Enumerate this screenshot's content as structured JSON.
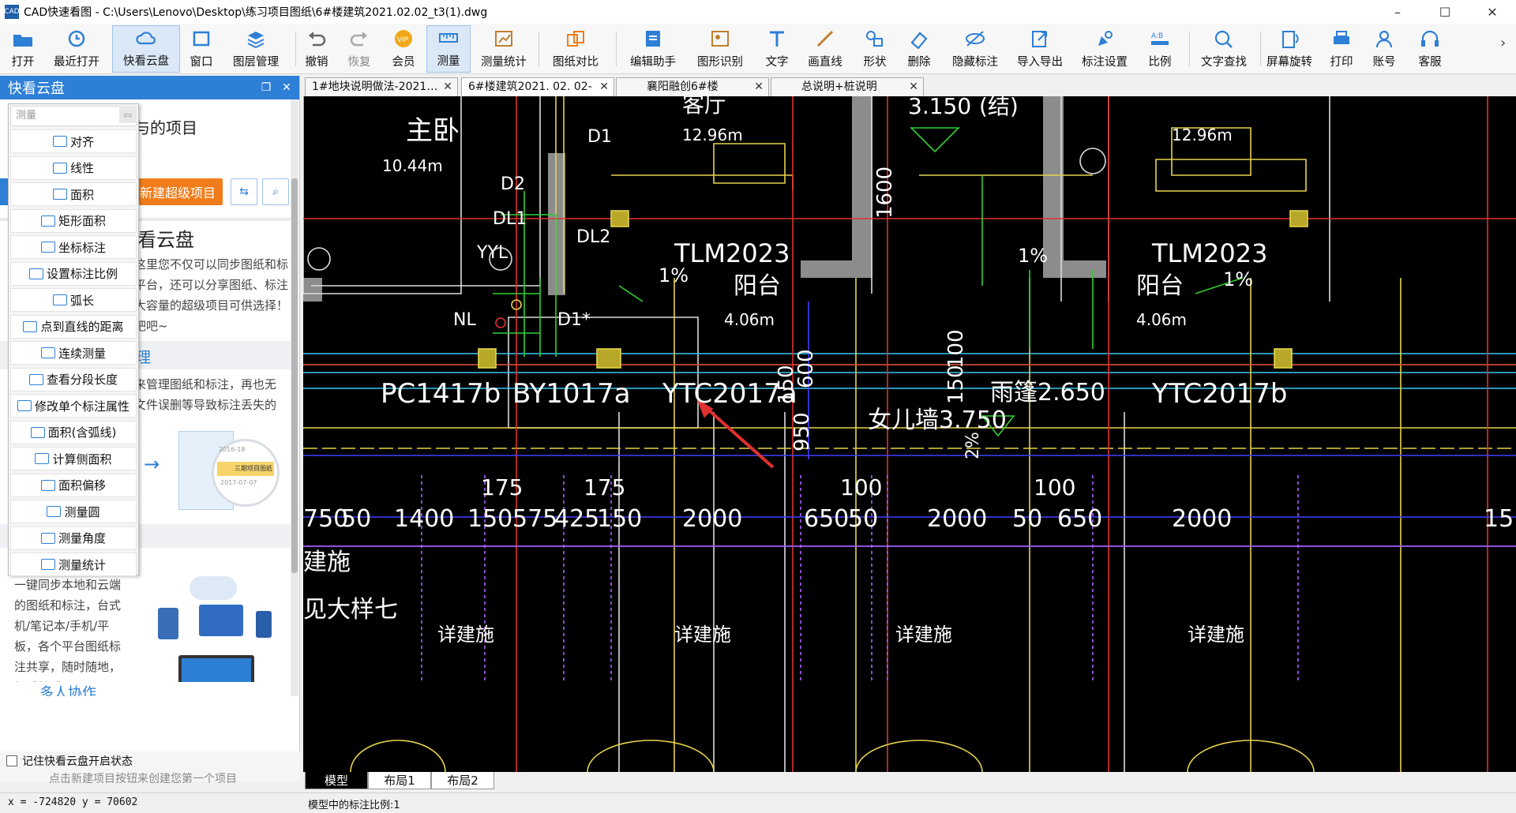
{
  "window": {
    "app_logo": "CAD",
    "title": "CAD快速看图 - C:\\Users\\Lenovo\\Desktop\\练习项目图纸\\6#楼建筑2021.02.02_t3(1).dwg",
    "minimize": "–",
    "maximize": "☐",
    "close": "✕"
  },
  "toolbar": {
    "items": [
      {
        "label": "打开",
        "icon": "folder-open-icon"
      },
      {
        "label": "最近打开",
        "icon": "recent-icon"
      },
      {
        "label": "快看云盘",
        "icon": "cloud-icon"
      },
      {
        "label": "窗口",
        "icon": "window-icon"
      },
      {
        "label": "图层管理",
        "icon": "layers-icon"
      },
      {
        "label": "撤销",
        "icon": "undo-icon"
      },
      {
        "label": "恢复",
        "icon": "redo-icon"
      },
      {
        "label": "会员",
        "icon": "vip-icon"
      },
      {
        "label": "测量",
        "icon": "ruler-icon"
      },
      {
        "label": "测量统计",
        "icon": "measure-stats-icon"
      },
      {
        "label": "图纸对比",
        "icon": "compare-icon"
      },
      {
        "label": "编辑助手",
        "icon": "edit-assistant-icon"
      },
      {
        "label": "图形识别",
        "icon": "shape-recognize-icon"
      },
      {
        "label": "文字",
        "icon": "text-icon"
      },
      {
        "label": "画直线",
        "icon": "line-icon"
      },
      {
        "label": "形状",
        "icon": "shape-icon"
      },
      {
        "label": "删除",
        "icon": "eraser-icon"
      },
      {
        "label": "隐藏标注",
        "icon": "hide-annotation-icon"
      },
      {
        "label": "导入导出",
        "icon": "import-export-icon"
      },
      {
        "label": "标注设置",
        "icon": "annotation-settings-icon"
      },
      {
        "label": "比例",
        "icon": "scale-icon"
      },
      {
        "label": "文字查找",
        "icon": "text-search-icon"
      },
      {
        "label": "屏幕旋转",
        "icon": "rotate-screen-icon"
      },
      {
        "label": "打印",
        "icon": "printer-icon"
      },
      {
        "label": "账号",
        "icon": "account-icon"
      },
      {
        "label": "客服",
        "icon": "headset-icon"
      }
    ],
    "more": "›"
  },
  "left_panel": {
    "title": "快看云盘",
    "restore_icon": "❐",
    "close_icon": "✕",
    "heading_partial": "与的项目",
    "new_project_button": "新建超级项目",
    "intro_title_partial": "看云盘",
    "intro_lines": [
      "这里您不仅可以同步图纸和标",
      "平台，还可以分享图纸、标注",
      "大容量的超级项目可供选择！",
      "吧吧~"
    ],
    "section2_partial": "理",
    "section2_lines": [
      "来管理图纸和标注，再也无",
      "文件误删等导致标注丢失的"
    ],
    "thumb_date1": "2016-18",
    "thumb_caption": "三期项目图纸",
    "thumb_date2": "2017-07-07",
    "sync_lines": [
      "一键同步本地和云端",
      "的图纸和标注，台式",
      "机/笔记本/手机/平",
      "板，各个平台图纸标",
      "注共享，随时随地，",
      "想看就看。"
    ],
    "section3_partial": "多人协作",
    "remember_label": "记住快看云盘开启状态",
    "footer_hint": "点击新建项目按钮来创建您第一个项目"
  },
  "measure_menu": {
    "search_placeholder": "测量",
    "items": [
      "对齐",
      "线性",
      "面积",
      "矩形面积",
      "坐标标注",
      "设置标注比例",
      "弧长",
      "点到直线的距离",
      "连续测量",
      "查看分段长度",
      "修改单个标注属性",
      "面积(含弧线)",
      "计算侧面积",
      "面积偏移",
      "测量圆",
      "测量角度",
      "测量统计"
    ]
  },
  "doc_tabs": [
    {
      "label": "1#地块说明做法-2021…",
      "active": false
    },
    {
      "label": "6#楼建筑2021. 02. 02-",
      "active": true
    },
    {
      "label": "襄阳融创6#楼",
      "active": false
    },
    {
      "label": "总说明+桩说明",
      "active": false
    }
  ],
  "drawing": {
    "room1_name": "主卧",
    "room1_area": "10.44m",
    "room2_name": "客厅",
    "room2_area": "12.96m",
    "room3_area": "12.96m",
    "level_label": "3.150",
    "structure_note": "(结)",
    "door1": "TLM2023",
    "door2": "TLM2023",
    "balcony": "阳台",
    "balcony_area": "4.06m",
    "slope": "1%",
    "dims_v": [
      "1600",
      "600",
      "150",
      "100",
      "150",
      "950",
      "2%"
    ],
    "labels": [
      "D2",
      "DL1",
      "D1",
      "DL2",
      "YYL",
      "NL",
      "D1*"
    ],
    "windows": [
      "PC1417b",
      "BY1017a",
      "YTC2017a",
      "YTC2017b"
    ],
    "parapet": "女儿墙3.750",
    "canopy": "雨篷2.650",
    "dims_h_top": [
      "175",
      "175",
      "100",
      "100"
    ],
    "dims_h": [
      "750",
      "50",
      "1400",
      "150",
      "575",
      "425",
      "150",
      "2000",
      "650",
      "50",
      "2000",
      "50",
      "650",
      "2000",
      "15"
    ],
    "side_notes": [
      "建施",
      "见大样七"
    ],
    "bottom_notes": [
      "详建施",
      "详建施",
      "详建施",
      "详建施"
    ]
  },
  "layout_tabs": [
    "模型",
    "布局1",
    "布局2"
  ],
  "status": {
    "coords": "x = -724820 y = 70602",
    "scale_info": "模型中的标注比例:1"
  },
  "colors": {
    "accent": "#2e7fd6",
    "orange_button": "#f07d1a",
    "canvas_bg": "#000000",
    "annotation_arrow": "#e03030"
  }
}
